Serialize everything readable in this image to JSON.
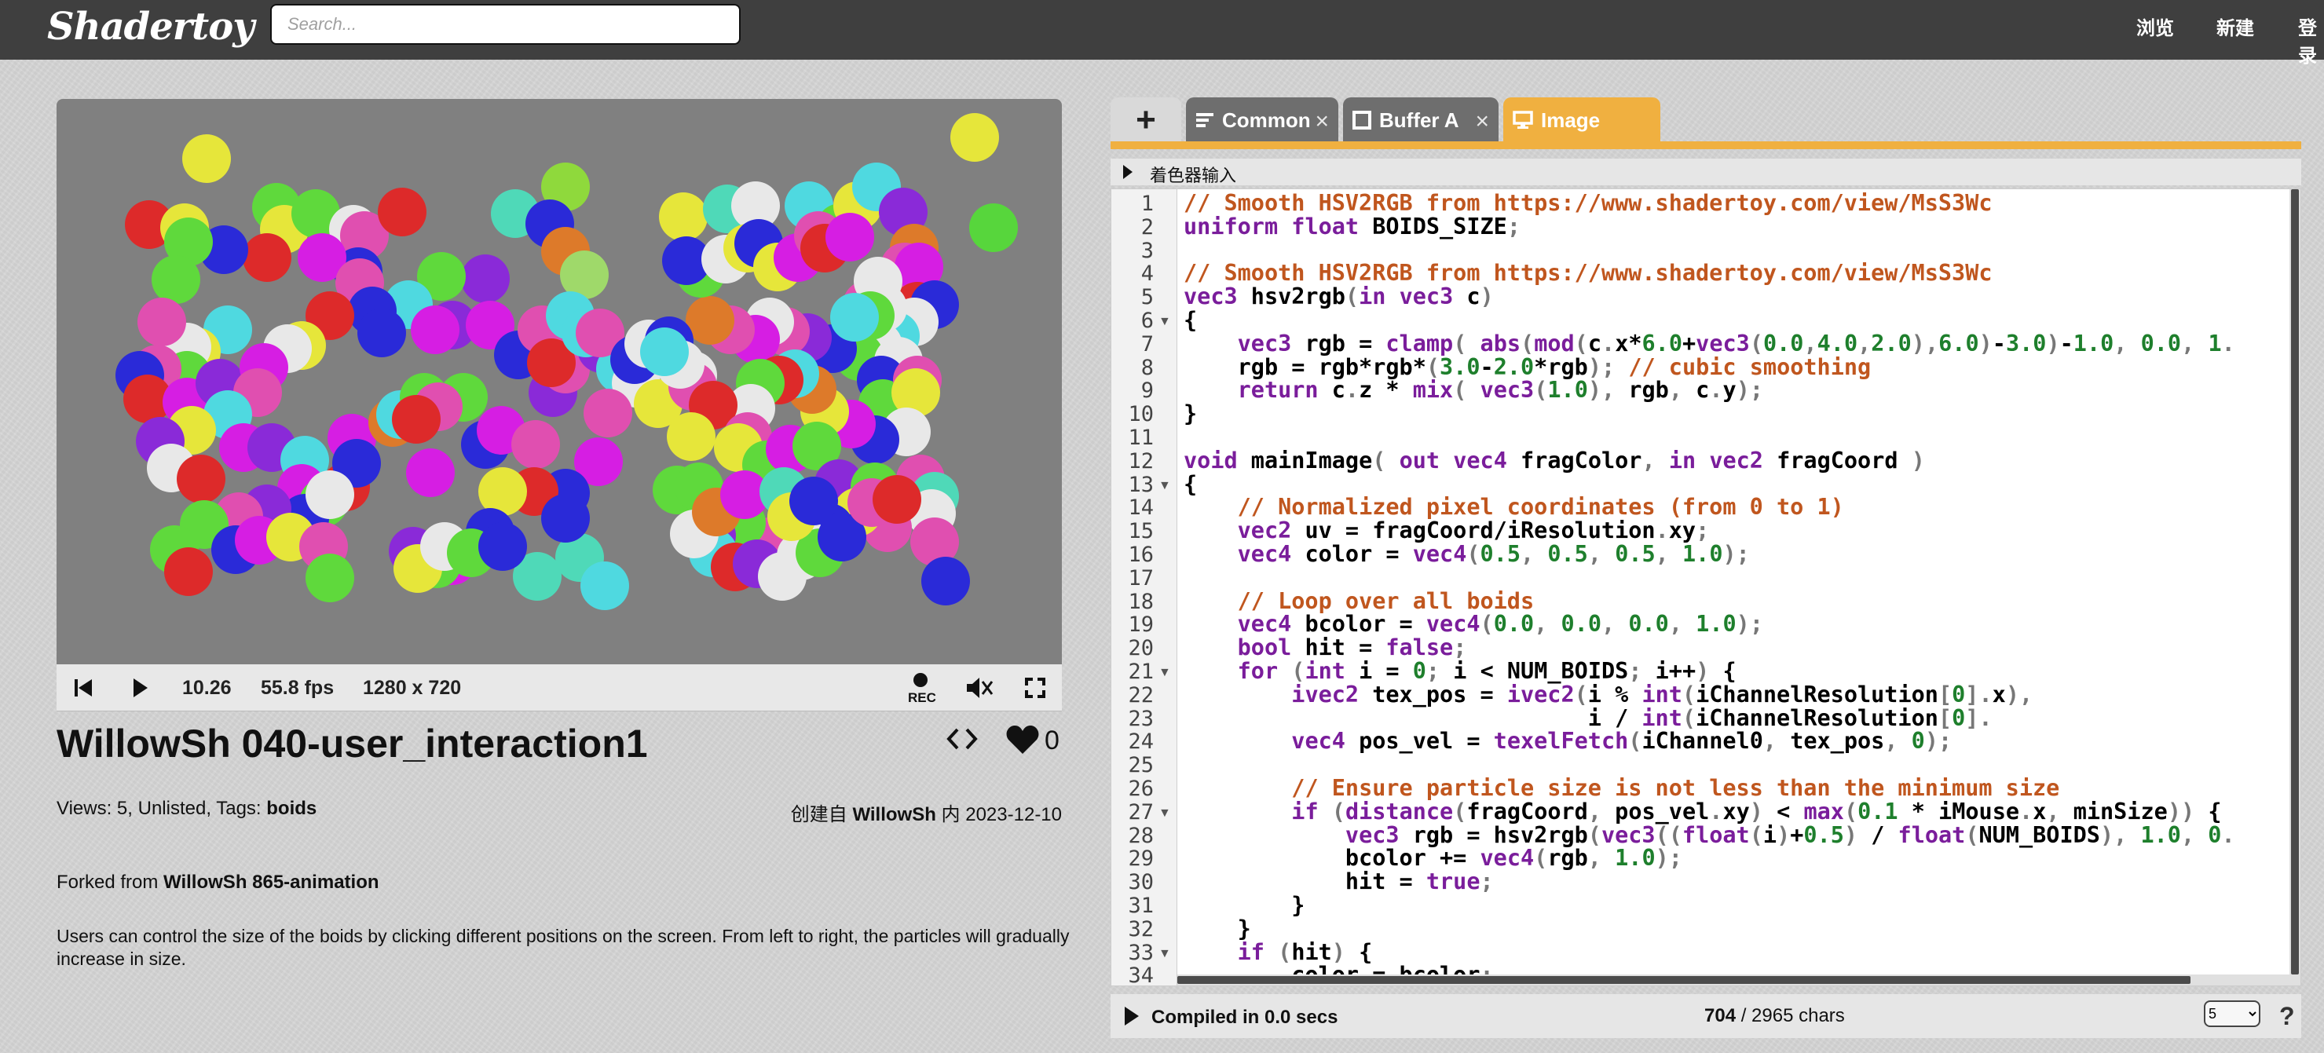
{
  "header": {
    "logo": "Shadertoy",
    "search_placeholder": "Search...",
    "nav": [
      "浏览",
      "新建",
      "登录"
    ]
  },
  "player": {
    "time": "10.26",
    "fps": "55.8 fps",
    "resolution": "1280 x 720",
    "rec_label": "REC",
    "background": "#808080",
    "particles": [
      [
        263,
        202,
        "#e6e63a"
      ],
      [
        1241,
        175,
        "#e6e63a"
      ],
      [
        1265,
        290,
        "#57d63c"
      ],
      [
        190,
        286,
        "#dd2a2a"
      ],
      [
        235,
        290,
        "#e6e63a"
      ],
      [
        352,
        264,
        "#5fd93c"
      ],
      [
        362,
        292,
        "#e6e63a"
      ],
      [
        402,
        272,
        "#5fd93c"
      ],
      [
        450,
        292,
        "#e8e8e8"
      ],
      [
        464,
        300,
        "#e04fb0"
      ],
      [
        512,
        270,
        "#dd2a2a"
      ],
      [
        456,
        346,
        "#2a2ad8"
      ],
      [
        410,
        328,
        "#d61ee3"
      ],
      [
        340,
        328,
        "#dd2a2a"
      ],
      [
        285,
        318,
        "#2a2ad8"
      ],
      [
        240,
        308,
        "#5fd93c"
      ],
      [
        224,
        356,
        "#5fd93c"
      ],
      [
        458,
        360,
        "#e04fb0"
      ],
      [
        720,
        238,
        "#8fd93c"
      ],
      [
        656,
        272,
        "#4fd9b8"
      ],
      [
        700,
        285,
        "#2a2ad8"
      ],
      [
        720,
        320,
        "#dd7a2a"
      ],
      [
        744,
        350,
        "#9fd96a"
      ],
      [
        618,
        355,
        "#8a2ad8"
      ],
      [
        562,
        352,
        "#5fd93c"
      ],
      [
        520,
        388,
        "#4fd9e0"
      ],
      [
        474,
        396,
        "#2a2ad8"
      ],
      [
        420,
        402,
        "#dd2a2a"
      ],
      [
        384,
        440,
        "#e6e63a"
      ],
      [
        366,
        444,
        "#e8e8e8"
      ],
      [
        290,
        420,
        "#4fd9e0"
      ],
      [
        250,
        448,
        "#e6e63a"
      ],
      [
        238,
        442,
        "#e8e8e8"
      ],
      [
        206,
        410,
        "#e04fb0"
      ],
      [
        238,
        478,
        "#5fd93c"
      ],
      [
        200,
        470,
        "#e04fb0"
      ],
      [
        178,
        478,
        "#2a2ad8"
      ],
      [
        188,
        508,
        "#dd2a2a"
      ],
      [
        238,
        512,
        "#d61ee3"
      ],
      [
        280,
        488,
        "#8a2ad8"
      ],
      [
        336,
        468,
        "#d61ee3"
      ],
      [
        328,
        500,
        "#e04fb0"
      ],
      [
        290,
        528,
        "#4fd9e0"
      ],
      [
        244,
        548,
        "#e6e63a"
      ],
      [
        204,
        562,
        "#8a2ad8"
      ],
      [
        218,
        596,
        "#e8e8e8"
      ],
      [
        256,
        610,
        "#dd2a2a"
      ],
      [
        310,
        570,
        "#d61ee3"
      ],
      [
        346,
        570,
        "#8a2ad8"
      ],
      [
        388,
        586,
        "#4fd9e0"
      ],
      [
        384,
        622,
        "#d61ee3"
      ],
      [
        412,
        640,
        "#5fd93c"
      ],
      [
        388,
        660,
        "#2a2ad8"
      ],
      [
        340,
        648,
        "#8a2ad8"
      ],
      [
        304,
        658,
        "#e04fb0"
      ],
      [
        260,
        668,
        "#5fd93c"
      ],
      [
        222,
        700,
        "#5fd93c"
      ],
      [
        240,
        728,
        "#dd2a2a"
      ],
      [
        300,
        700,
        "#2a2ad8"
      ],
      [
        330,
        688,
        "#d61ee3"
      ],
      [
        370,
        684,
        "#e6e63a"
      ],
      [
        412,
        696,
        "#e04fb0"
      ],
      [
        420,
        736,
        "#5fd93c"
      ],
      [
        440,
        620,
        "#dd2a2a"
      ],
      [
        448,
        558,
        "#d61ee3"
      ],
      [
        454,
        590,
        "#2a2ad8"
      ],
      [
        420,
        630,
        "#e8e8e8"
      ],
      [
        500,
        538,
        "#dd7a2a"
      ],
      [
        510,
        528,
        "#4fd9e0"
      ],
      [
        540,
        506,
        "#5fd93c"
      ],
      [
        590,
        506,
        "#5fd93c"
      ],
      [
        618,
        566,
        "#2a2ad8"
      ],
      [
        638,
        548,
        "#d61ee3"
      ],
      [
        682,
        566,
        "#e04fb0"
      ],
      [
        704,
        500,
        "#8a2ad8"
      ],
      [
        730,
        444,
        "#e04fb0"
      ],
      [
        720,
        470,
        "#e04fb0"
      ],
      [
        766,
        444,
        "#8a2ad8"
      ],
      [
        790,
        470,
        "#4fd9e0"
      ],
      [
        810,
        488,
        "#e8e8e8"
      ],
      [
        774,
        526,
        "#e04fb0"
      ],
      [
        838,
        514,
        "#e6e63a"
      ],
      [
        762,
        588,
        "#d61ee3"
      ],
      [
        720,
        628,
        "#2a2ad8"
      ],
      [
        680,
        626,
        "#dd2a2a"
      ],
      [
        640,
        626,
        "#e6e63a"
      ],
      [
        558,
        518,
        "#e04fb0"
      ],
      [
        530,
        534,
        "#dd2a2a"
      ],
      [
        548,
        602,
        "#d61ee3"
      ],
      [
        486,
        424,
        "#2a2ad8"
      ],
      [
        576,
        414,
        "#8a2ad8"
      ],
      [
        554,
        420,
        "#d61ee3"
      ],
      [
        624,
        414,
        "#d61ee3"
      ],
      [
        660,
        452,
        "#2a2ad8"
      ],
      [
        690,
        420,
        "#e04fb0"
      ],
      [
        702,
        462,
        "#dd2a2a"
      ],
      [
        726,
        402,
        "#4fd9e0"
      ],
      [
        746,
        424,
        "#4fd9e0"
      ],
      [
        764,
        424,
        "#e04fb0"
      ],
      [
        808,
        458,
        "#2a2ad8"
      ],
      [
        826,
        438,
        "#e8e8e8"
      ],
      [
        882,
        478,
        "#e8e8e8"
      ],
      [
        882,
        492,
        "#e04fb0"
      ],
      [
        738,
        710,
        "#4fd9b8"
      ],
      [
        770,
        746,
        "#4fd9e0"
      ],
      [
        684,
        734,
        "#4fd9b8"
      ],
      [
        624,
        678,
        "#2a2ad8"
      ],
      [
        576,
        714,
        "#d61ee3"
      ],
      [
        556,
        718,
        "#5fd93c"
      ],
      [
        526,
        702,
        "#8a2ad8"
      ],
      [
        532,
        724,
        "#e6e63a"
      ],
      [
        566,
        696,
        "#e8e8e8"
      ],
      [
        600,
        704,
        "#5fd93c"
      ],
      [
        640,
        696,
        "#2a2ad8"
      ],
      [
        720,
        660,
        "#2a2ad8"
      ],
      [
        870,
        276,
        "#e6e63a"
      ],
      [
        926,
        266,
        "#4fd9b8"
      ],
      [
        962,
        262,
        "#e8e8e8"
      ],
      [
        1030,
        262,
        "#4fd9e0"
      ],
      [
        1070,
        290,
        "#5fd93c"
      ],
      [
        1092,
        262,
        "#e6e63a"
      ],
      [
        1116,
        238,
        "#4fd9e0"
      ],
      [
        1150,
        270,
        "#8a2ad8"
      ],
      [
        1164,
        316,
        "#dd7a2a"
      ],
      [
        1152,
        340,
        "#e04fb0"
      ],
      [
        1170,
        340,
        "#d61ee3"
      ],
      [
        1168,
        390,
        "#dd2a2a"
      ],
      [
        1190,
        388,
        "#2a2ad8"
      ],
      [
        1164,
        410,
        "#e8e8e8"
      ],
      [
        1140,
        428,
        "#4fd9e0"
      ],
      [
        1118,
        440,
        "#e8e8e8"
      ],
      [
        1094,
        454,
        "#5fd93c"
      ],
      [
        1060,
        444,
        "#2a2ad8"
      ],
      [
        1028,
        430,
        "#8a2ad8"
      ],
      [
        1000,
        422,
        "#e04fb0"
      ],
      [
        980,
        410,
        "#e8e8e8"
      ],
      [
        962,
        432,
        "#d61ee3"
      ],
      [
        930,
        420,
        "#e04fb0"
      ],
      [
        904,
        408,
        "#dd7a2a"
      ],
      [
        892,
        348,
        "#5fd93c"
      ],
      [
        874,
        332,
        "#2a2ad8"
      ],
      [
        924,
        330,
        "#e8e8e8"
      ],
      [
        952,
        316,
        "#e6e63a"
      ],
      [
        966,
        310,
        "#2a2ad8"
      ],
      [
        990,
        340,
        "#e6e63a"
      ],
      [
        1016,
        328,
        "#d61ee3"
      ],
      [
        1042,
        300,
        "#e04fb0"
      ],
      [
        1050,
        316,
        "#dd2a2a"
      ],
      [
        1082,
        302,
        "#d61ee3"
      ],
      [
        1104,
        388,
        "#e04fb0"
      ],
      [
        1124,
        392,
        "#e8e8e8"
      ],
      [
        1144,
        460,
        "#e8e8e8"
      ],
      [
        1122,
        484,
        "#2a2ad8"
      ],
      [
        1124,
        514,
        "#5fd93c"
      ],
      [
        1168,
        484,
        "#e04fb0"
      ],
      [
        1166,
        500,
        "#e6e63a"
      ],
      [
        1154,
        550,
        "#e8e8e8"
      ],
      [
        1114,
        560,
        "#2a2ad8"
      ],
      [
        1084,
        540,
        "#d61ee3"
      ],
      [
        1050,
        524,
        "#e6e63a"
      ],
      [
        1034,
        496,
        "#dd7a2a"
      ],
      [
        1012,
        476,
        "#4fd9e0"
      ],
      [
        992,
        484,
        "#dd2a2a"
      ],
      [
        968,
        488,
        "#5fd93c"
      ],
      [
        956,
        520,
        "#e8e8e8"
      ],
      [
        908,
        516,
        "#dd2a2a"
      ],
      [
        952,
        556,
        "#e04fb0"
      ],
      [
        940,
        570,
        "#e6e63a"
      ],
      [
        976,
        592,
        "#5fd93c"
      ],
      [
        1006,
        572,
        "#d61ee3"
      ],
      [
        1040,
        568,
        "#5fd93c"
      ],
      [
        1068,
        616,
        "#8a2ad8"
      ],
      [
        1114,
        620,
        "#5fd93c"
      ],
      [
        1172,
        610,
        "#e04fb0"
      ],
      [
        1190,
        632,
        "#4fd9b8"
      ],
      [
        1186,
        654,
        "#e8e8e8"
      ],
      [
        1190,
        690,
        "#e04fb0"
      ],
      [
        1204,
        740,
        "#2a2ad8"
      ],
      [
        1130,
        672,
        "#e04fb0"
      ],
      [
        1092,
        652,
        "#e6e63a"
      ],
      [
        1056,
        672,
        "#2a2ad8"
      ],
      [
        1018,
        684,
        "#e8e8e8"
      ],
      [
        980,
        690,
        "#e04fb0"
      ],
      [
        944,
        666,
        "#5fd93c"
      ],
      [
        906,
        682,
        "#8a2ad8"
      ],
      [
        908,
        704,
        "#4fd9e0"
      ],
      [
        936,
        722,
        "#dd2a2a"
      ],
      [
        964,
        718,
        "#8a2ad8"
      ],
      [
        996,
        734,
        "#e8e8e8"
      ],
      [
        1020,
        708,
        "#e8e8e8"
      ],
      [
        1044,
        704,
        "#5fd93c"
      ],
      [
        862,
        624,
        "#5fd93c"
      ],
      [
        890,
        620,
        "#5fd93c"
      ],
      [
        884,
        680,
        "#e8e8e8"
      ],
      [
        912,
        652,
        "#dd7a2a"
      ],
      [
        948,
        630,
        "#d61ee3"
      ],
      [
        998,
        626,
        "#4fd9b8"
      ],
      [
        1008,
        658,
        "#e6e63a"
      ],
      [
        1036,
        638,
        "#2a2ad8"
      ],
      [
        1072,
        684,
        "#2a2ad8"
      ],
      [
        1110,
        640,
        "#e04fb0"
      ],
      [
        1142,
        636,
        "#dd2a2a"
      ],
      [
        880,
        556,
        "#e6e63a"
      ],
      [
        852,
        434,
        "#2a2ad8"
      ],
      [
        866,
        464,
        "#e8e8e8"
      ],
      [
        846,
        448,
        "#4fd9e0"
      ],
      [
        1118,
        358,
        "#e8e8e8"
      ],
      [
        1108,
        402,
        "#5fd93c"
      ],
      [
        1088,
        404,
        "#4fd9e0"
      ]
    ]
  },
  "shader": {
    "title": "WillowSh 040-user_interaction1",
    "likes": "0",
    "meta_prefix": "Views: 5, Unlisted, Tags: ",
    "tag": "boids",
    "created_prefix": "创建自 ",
    "author": "WillowSh",
    "created_mid": " 内 ",
    "date": "2023-12-10",
    "forked_prefix": "Forked from ",
    "forked_source": "WillowSh 865-animation",
    "description": "Users can control the size of the boids by clicking different positions on the screen. From left to right, the particles will gradually increase in size."
  },
  "editor": {
    "tabs": [
      {
        "label": "Common",
        "icon": "lines-icon"
      },
      {
        "label": "Buffer A",
        "icon": "square-icon"
      },
      {
        "label": "Image",
        "icon": "monitor-icon"
      }
    ],
    "add_tab_label": "+",
    "inputs_label": "着色器输入",
    "compile_status": "Compiled in 0.0 secs",
    "char_used": "704",
    "char_total": " / 2965 chars",
    "font_size_option": "5",
    "help_label": "?",
    "lines": [
      "// Smooth HSV2RGB from https://www.shadertoy.com/view/MsS3Wc",
      "uniform float BOIDS_SIZE;",
      "",
      "// Smooth HSV2RGB from https://www.shadertoy.com/view/MsS3Wc",
      "vec3 hsv2rgb(in vec3 c)",
      "{",
      "    vec3 rgb = clamp( abs(mod(c.x*6.0+vec3(0.0,4.0,2.0),6.0)-3.0)-1.0, 0.0, 1.",
      "    rgb = rgb*rgb*(3.0-2.0*rgb); // cubic smoothing",
      "    return c.z * mix( vec3(1.0), rgb, c.y);",
      "}",
      "",
      "void mainImage( out vec4 fragColor, in vec2 fragCoord )",
      "{",
      "    // Normalized pixel coordinates (from 0 to 1)",
      "    vec2 uv = fragCoord/iResolution.xy;",
      "    vec4 color = vec4(0.5, 0.5, 0.5, 1.0);",
      "",
      "    // Loop over all boids",
      "    vec4 bcolor = vec4(0.0, 0.0, 0.0, 1.0);",
      "    bool hit = false;",
      "    for (int i = 0; i < NUM_BOIDS; i++) {",
      "        ivec2 tex_pos = ivec2(i % int(iChannelResolution[0].x),",
      "                              i / int(iChannelResolution[0].",
      "        vec4 pos_vel = texelFetch(iChannel0, tex_pos, 0);",
      "",
      "        // Ensure particle size is not less than the minimum size",
      "        if (distance(fragCoord, pos_vel.xy) < max(0.1 * iMouse.x, minSize)) {",
      "            vec3 rgb = hsv2rgb(vec3((float(i)+0.5) / float(NUM_BOIDS), 1.0, 0.",
      "            bcolor += vec4(rgb, 1.0);",
      "            hit = true;",
      "        }",
      "    }",
      "    if (hit) {",
      "        color = bcolor;"
    ],
    "fold_lines": [
      6,
      13,
      21,
      27,
      33
    ]
  },
  "colors": {
    "accent": "#f0b040",
    "topbar": "#3f3f3f",
    "comment": "#c0561e",
    "keyword": "#7a1d9b",
    "number": "#1e7f2c"
  }
}
